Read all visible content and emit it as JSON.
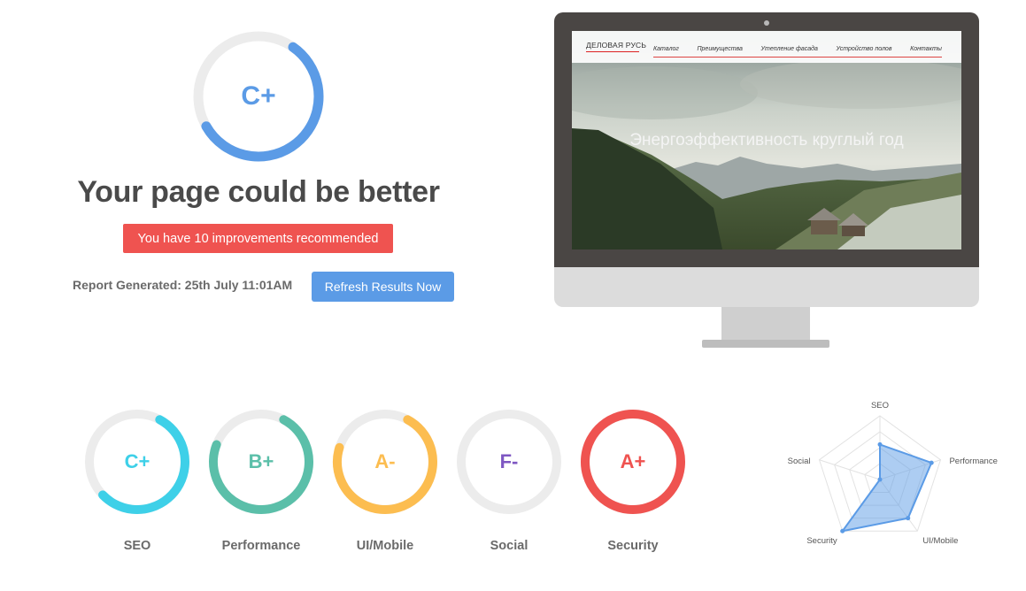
{
  "summary": {
    "grade": "C+",
    "grade_fraction": 0.57,
    "grade_color": "#5b9be6",
    "headline": "Your page could be better",
    "improvements_text": "You have 10 improvements recommended",
    "report_generated": "Report Generated: 25th July 11:01AM",
    "refresh_label": "Refresh Results Now"
  },
  "preview": {
    "site_logo": "ДЕЛОВАЯ РУСЬ",
    "nav_items": [
      "Каталог",
      "Преимущества",
      "Утепление фасада",
      "Устройство полов",
      "Контакты"
    ],
    "hero_title": "Энергоэффективность круглый год"
  },
  "categories": [
    {
      "name": "SEO",
      "grade": "C+",
      "color": "#3ed0e8",
      "fraction": 0.55
    },
    {
      "name": "Performance",
      "grade": "B+",
      "color": "#5bbfa9",
      "fraction": 0.73
    },
    {
      "name": "UI/Mobile",
      "grade": "A-",
      "color": "#fcbd50",
      "fraction": 0.72
    },
    {
      "name": "Social",
      "grade": "F-",
      "color": "#7e57c2",
      "fraction": 0.0
    },
    {
      "name": "Security",
      "grade": "A+",
      "color": "#ef5350",
      "fraction": 1.0
    }
  ],
  "chart_data": {
    "type": "radar",
    "axes": [
      "SEO",
      "Performance",
      "UI/Mobile",
      "Security",
      "Social"
    ],
    "values": [
      0.55,
      0.85,
      0.75,
      1.0,
      0.0
    ],
    "range": [
      0,
      1
    ],
    "rings": 4,
    "fill_color": "#5b9be6"
  }
}
